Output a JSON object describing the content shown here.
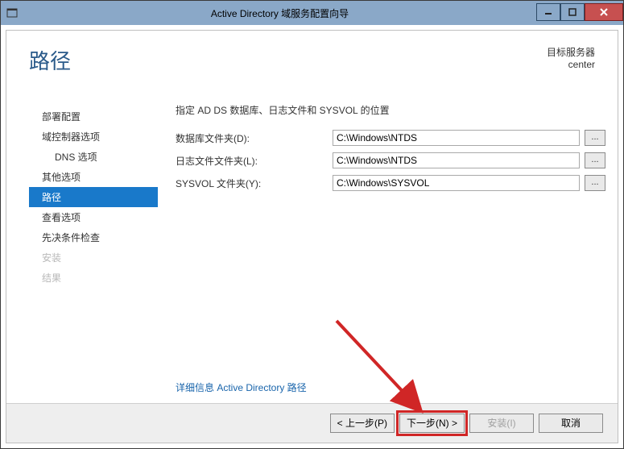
{
  "title": "Active Directory 域服务配置向导",
  "page_title": "路径",
  "target": {
    "label": "目标服务器",
    "value": "center"
  },
  "sidebar": {
    "items": [
      {
        "label": "部署配置",
        "indent": false,
        "selected": false,
        "disabled": false
      },
      {
        "label": "域控制器选项",
        "indent": false,
        "selected": false,
        "disabled": false
      },
      {
        "label": "DNS 选项",
        "indent": true,
        "selected": false,
        "disabled": false
      },
      {
        "label": "其他选项",
        "indent": false,
        "selected": false,
        "disabled": false
      },
      {
        "label": "路径",
        "indent": false,
        "selected": true,
        "disabled": false
      },
      {
        "label": "查看选项",
        "indent": false,
        "selected": false,
        "disabled": false
      },
      {
        "label": "先决条件检查",
        "indent": false,
        "selected": false,
        "disabled": false
      },
      {
        "label": "安装",
        "indent": false,
        "selected": false,
        "disabled": true
      },
      {
        "label": "结果",
        "indent": false,
        "selected": false,
        "disabled": true
      }
    ]
  },
  "content": {
    "instruction": "指定 AD DS 数据库、日志文件和 SYSVOL 的位置",
    "fields": [
      {
        "label": "数据库文件夹(D):",
        "value": "C:\\Windows\\NTDS"
      },
      {
        "label": "日志文件文件夹(L):",
        "value": "C:\\Windows\\NTDS"
      },
      {
        "label": "SYSVOL 文件夹(Y):",
        "value": "C:\\Windows\\SYSVOL"
      }
    ],
    "browse_label": "...",
    "more_link": "详细信息 Active Directory 路径"
  },
  "footer": {
    "prev": "< 上一步(P)",
    "next": "下一步(N) >",
    "install": "安装(I)",
    "cancel": "取消"
  }
}
